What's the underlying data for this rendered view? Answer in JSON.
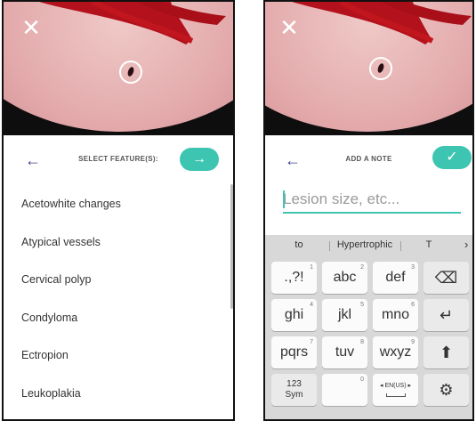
{
  "left_screen": {
    "close_icon": "close-icon",
    "header_title": "SELECT FEATURE(S):",
    "back_icon": "arrow-left-icon",
    "next_icon": "arrow-right-icon",
    "features": [
      "Acetowhite changes",
      "Atypical vessels",
      "Cervical polyp",
      "Condyloma",
      "Ectropion",
      "Leukoplakia"
    ]
  },
  "right_screen": {
    "close_icon": "close-icon",
    "header_title": "ADD A NOTE",
    "back_icon": "arrow-left-icon",
    "confirm_icon": "check-icon",
    "note_placeholder": "Lesion size, etc...",
    "keyboard": {
      "suggestions": [
        "to",
        "Hypertrophic",
        "T"
      ],
      "rows": [
        [
          {
            "label": ".,?!",
            "sub": "1"
          },
          {
            "label": "abc",
            "sub": "2"
          },
          {
            "label": "def",
            "sub": "3"
          },
          {
            "label": "",
            "icon": "backspace-icon"
          }
        ],
        [
          {
            "label": "ghi",
            "sub": "4"
          },
          {
            "label": "jkl",
            "sub": "5"
          },
          {
            "label": "mno",
            "sub": "6"
          },
          {
            "label": "",
            "icon": "enter-icon"
          }
        ],
        [
          {
            "label": "pqrs",
            "sub": "7"
          },
          {
            "label": "tuv",
            "sub": "8"
          },
          {
            "label": "wxyz",
            "sub": "9"
          },
          {
            "label": "",
            "icon": "shift-icon"
          }
        ],
        [
          {
            "label": "123\nSym"
          },
          {
            "label": "",
            "sub": "0"
          },
          {
            "label": "EN(US)",
            "icon": "spacebar"
          },
          {
            "label": "",
            "icon": "settings-icon"
          }
        ]
      ]
    }
  },
  "colors": {
    "accent_teal": "#3ec5b2",
    "header_icon": "#3d3f8c",
    "keyboard_bg": "#d8d8d8"
  }
}
